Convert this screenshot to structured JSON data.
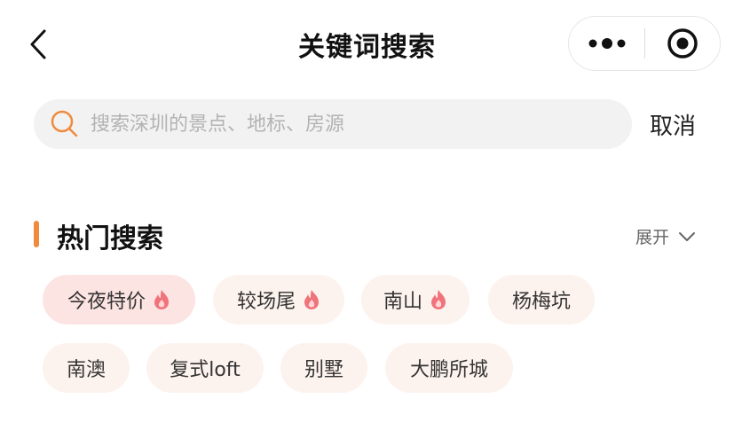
{
  "header": {
    "title": "关键词搜索"
  },
  "search": {
    "placeholder": "搜索深圳的景点、地标、房源",
    "value": "",
    "cancel_label": "取消"
  },
  "hot": {
    "title": "热门搜索",
    "expand_label": "展开",
    "tags": [
      {
        "label": "今夜特价",
        "hot": true
      },
      {
        "label": "较场尾",
        "hot": true
      },
      {
        "label": "南山",
        "hot": true
      },
      {
        "label": "杨梅坑",
        "hot": false
      },
      {
        "label": "南澳",
        "hot": false
      },
      {
        "label": "复式loft",
        "hot": false
      },
      {
        "label": "别墅",
        "hot": false
      },
      {
        "label": "大鹏所城",
        "hot": false
      }
    ]
  },
  "colors": {
    "accent": "#f08a3c",
    "tag_bg": "#fdf3ee",
    "tag_first_bg": "#fce4e2",
    "fire": "#f0727a"
  }
}
